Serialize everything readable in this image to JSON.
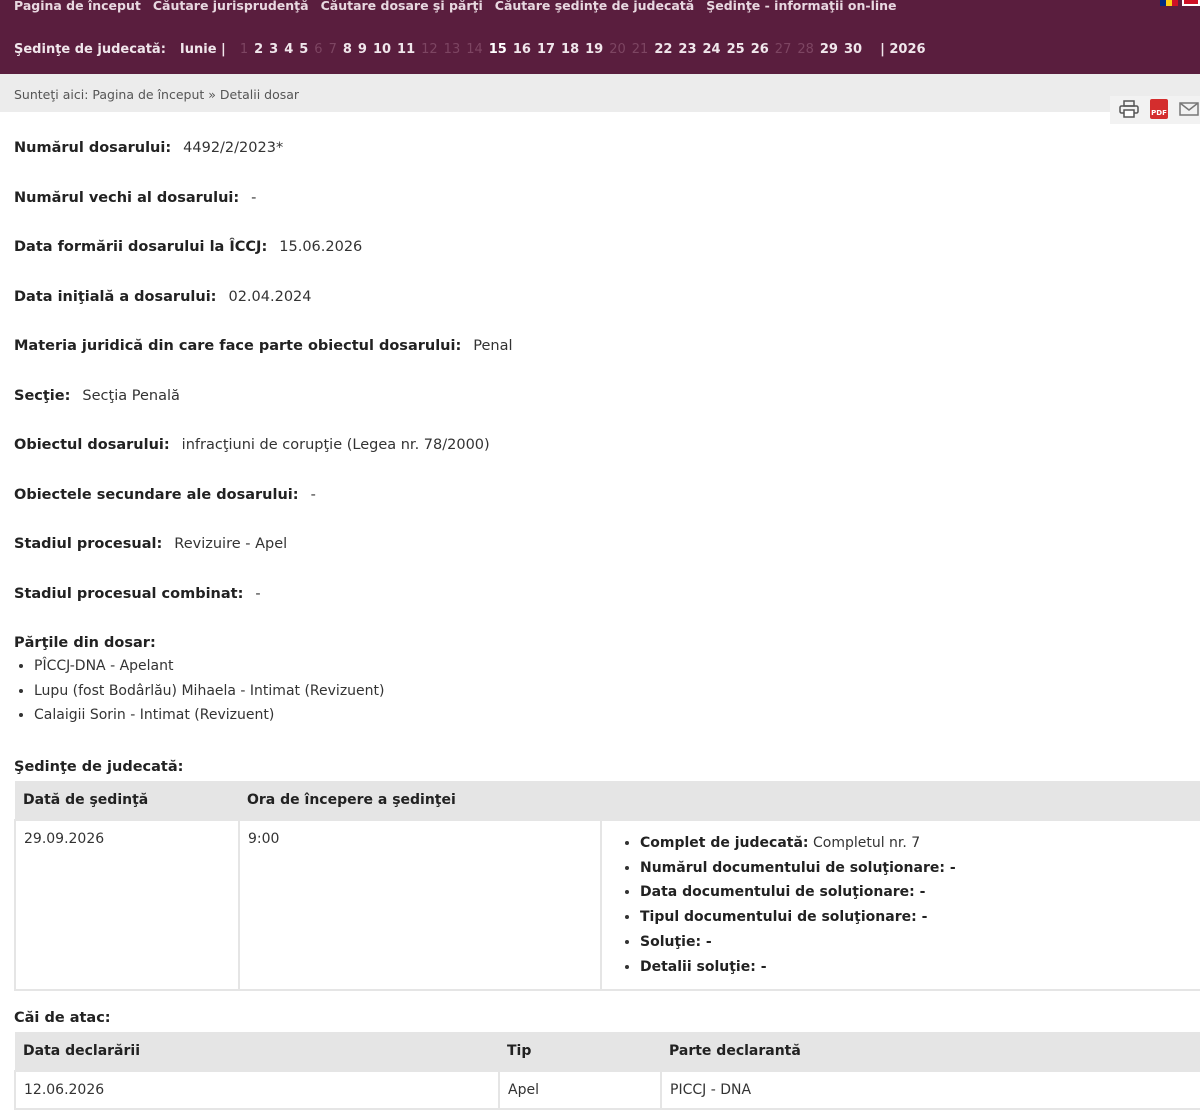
{
  "top_menu": [
    "Pagina de început",
    "Căutare jurisprudenţă",
    "Căutare dosare şi părţi",
    "Căutare şedinţe de judecată",
    "Şedinţe - informaţii on-line"
  ],
  "calendar": {
    "label": "Şedinţe de judecată:",
    "month": "Iunie |",
    "days": [
      {
        "d": "1",
        "enabled": false
      },
      {
        "d": "2",
        "enabled": true
      },
      {
        "d": "3",
        "enabled": true
      },
      {
        "d": "4",
        "enabled": true
      },
      {
        "d": "5",
        "enabled": true
      },
      {
        "d": "6",
        "enabled": false
      },
      {
        "d": "7",
        "enabled": false
      },
      {
        "d": "8",
        "enabled": true
      },
      {
        "d": "9",
        "enabled": true
      },
      {
        "d": "10",
        "enabled": true
      },
      {
        "d": "11",
        "enabled": true
      },
      {
        "d": "12",
        "enabled": false
      },
      {
        "d": "13",
        "enabled": false
      },
      {
        "d": "14",
        "enabled": false
      },
      {
        "d": "15",
        "enabled": true,
        "highlight": true
      },
      {
        "d": "16",
        "enabled": true
      },
      {
        "d": "17",
        "enabled": true
      },
      {
        "d": "18",
        "enabled": true
      },
      {
        "d": "19",
        "enabled": true
      },
      {
        "d": "20",
        "enabled": false
      },
      {
        "d": "21",
        "enabled": false
      },
      {
        "d": "22",
        "enabled": true
      },
      {
        "d": "23",
        "enabled": true
      },
      {
        "d": "24",
        "enabled": true
      },
      {
        "d": "25",
        "enabled": true
      },
      {
        "d": "26",
        "enabled": true
      },
      {
        "d": "27",
        "enabled": false
      },
      {
        "d": "28",
        "enabled": false
      },
      {
        "d": "29",
        "enabled": true
      },
      {
        "d": "30",
        "enabled": true
      }
    ],
    "year": "| 2026"
  },
  "breadcrumb": "Sunteţi aici: Pagina de început » Detalii dosar",
  "tools": {
    "print_icon": "printer-icon",
    "pdf_label": "PDF",
    "email_icon": "email-icon"
  },
  "fields": {
    "numar_label": "Numărul dosarului:",
    "numar_value": "4492/2/2023*",
    "numar_vechi_label": "Numărul vechi al dosarului:",
    "numar_vechi_value": "-",
    "data_formarii_label": "Data formării dosarului la ÎCCJ:",
    "data_formarii_value": "15.06.2026",
    "data_initiala_label": "Data iniţială a dosarului:",
    "data_initiala_value": "02.04.2024",
    "materia_label": "Materia juridică din care face parte obiectul dosarului:",
    "materia_value": "Penal",
    "sectie_label": "Secţie:",
    "sectie_value": "Secţia Penală",
    "obiect_label": "Obiectul dosarului:",
    "obiect_value": "infracţiuni de corupţie (Legea nr. 78/2000)",
    "obiecte_sec_label": "Obiectele secundare ale dosarului:",
    "obiecte_sec_value": "-",
    "stadiu_label": "Stadiul procesual:",
    "stadiu_value": "Revizuire - Apel",
    "stadiu_comb_label": "Stadiul procesual combinat:",
    "stadiu_comb_value": "-"
  },
  "parties": {
    "title": "Părţile din dosar:",
    "items": [
      "PÎCCJ-DNA - Apelant",
      "Lupu (fost Bodârlău) Mihaela - Intimat (Revizuent)",
      "Calaigii Sorin - Intimat (Revizuent)"
    ]
  },
  "hearings": {
    "title": "Şedinţe de judecată:",
    "headers": [
      "Dată de şedinţă",
      "Ora de începere a şedinţei",
      ""
    ],
    "rows": [
      {
        "date": "29.09.2026",
        "time": "9:00",
        "details": [
          {
            "label": "Complet de judecată:",
            "value": " Completul nr. 7"
          },
          {
            "label": "Numărul documentului de soluţionare: -",
            "value": ""
          },
          {
            "label": "Data documentului de soluţionare: -",
            "value": ""
          },
          {
            "label": "Tipul documentului de soluţionare: -",
            "value": ""
          },
          {
            "label": "Soluţie: -",
            "value": ""
          },
          {
            "label": "Detalii soluţie: -",
            "value": ""
          }
        ]
      }
    ]
  },
  "appeals": {
    "title": "Căi de atac:",
    "headers": [
      "Data declarării",
      "Tip",
      "Parte declarantă"
    ],
    "rows": [
      {
        "date": "12.06.2026",
        "type": "Apel",
        "party": "PICCJ - DNA"
      }
    ]
  }
}
